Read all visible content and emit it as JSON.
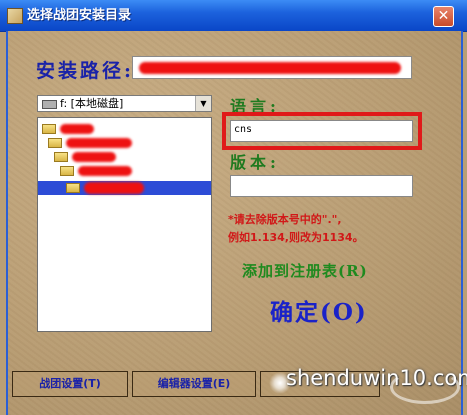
{
  "window": {
    "title": "选择战团安装目录",
    "close_glyph": "✕"
  },
  "path": {
    "label": "安装路径:",
    "value": ""
  },
  "drive": {
    "selected": "f: [本地磁盘]",
    "arrow_glyph": "▼"
  },
  "language": {
    "label": "语言:",
    "value": "cns"
  },
  "version": {
    "label": "版本:",
    "value": ""
  },
  "hint": {
    "line1": "*请去除版本号中的\".\",",
    "line2": "例如1.134,则改为1134。"
  },
  "buttons": {
    "register": "添加到注册表(R)",
    "confirm": "确定(O)",
    "team_settings": "战团设置(T)",
    "editor_settings": "编辑器设置(E)"
  },
  "watermark": "shenduwin10.com",
  "colors": {
    "titlebar": "#0a46c7",
    "label_blue": "#1a22a8",
    "label_green": "#1f7a1f",
    "hint_red": "#d11818",
    "highlight_red": "#e01919",
    "selection": "#2d4cd6"
  }
}
